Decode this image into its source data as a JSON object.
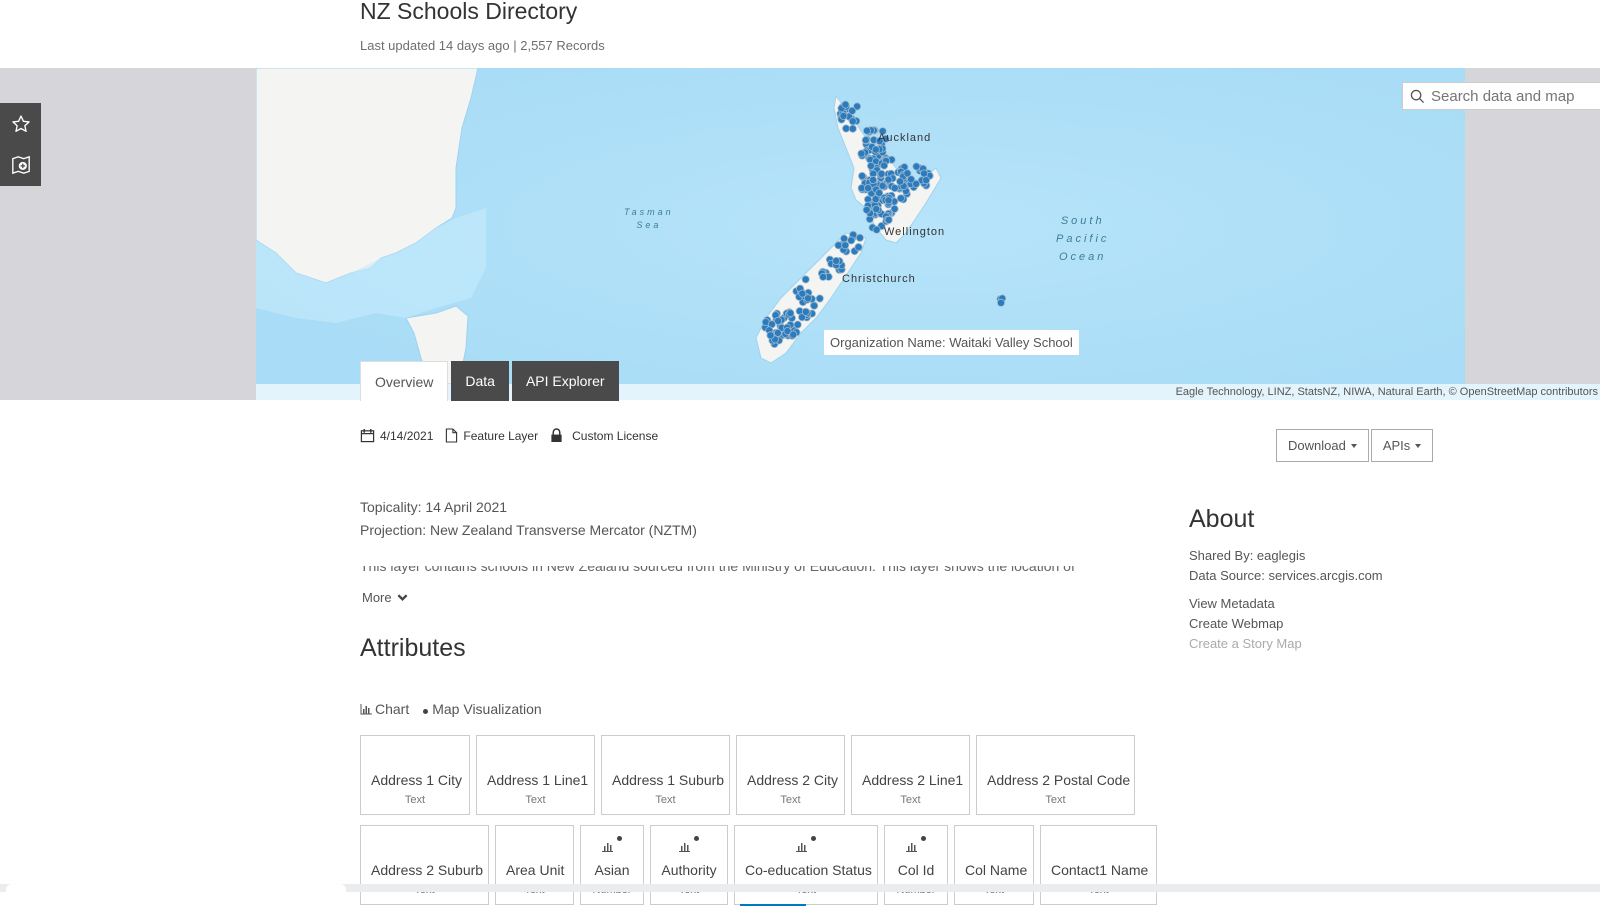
{
  "header": {
    "title": "NZ Schools Directory",
    "subtitle": "Last updated 14 days ago | 2,557 Records"
  },
  "side_toolbar": {
    "favorite_icon": "star-icon",
    "add_to_map_icon": "map-add-icon"
  },
  "search": {
    "placeholder": "Search data and map",
    "icon": "search-icon"
  },
  "map": {
    "labels": {
      "auckland": "Auckland",
      "wellington": "Wellington",
      "christchurch": "Christchurch",
      "tasman_line1": "Tasman",
      "tasman_line2": "Sea",
      "pacific_line1": "South",
      "pacific_line2": "Pacific",
      "pacific_line3": "Ocean"
    },
    "tooltip": "Organization Name: Waitaki Valley School",
    "attribution": "Eagle Technology, LINZ, StatsNZ, NIWA, Natural Earth, © OpenStreetMap contributors",
    "colors": {
      "water": "#aee1f9",
      "land": "#f4f4f2",
      "point": "#2b7bbf"
    }
  },
  "tabs": [
    {
      "label": "Overview",
      "active": true
    },
    {
      "label": "Data",
      "active": false
    },
    {
      "label": "API Explorer",
      "active": false
    }
  ],
  "meta": {
    "date": "4/14/2021",
    "type": "Feature Layer",
    "license": "Custom License"
  },
  "actions": {
    "download": "Download",
    "apis": "APIs"
  },
  "description": {
    "topicality": "Topicality: 14 April 2021",
    "projection": "Projection: New Zealand Transverse Mercator (NZTM)",
    "body_truncated": "This layer contains schools in New Zealand sourced from the Ministry of Education. This layer shows the location of",
    "more": "More"
  },
  "about": {
    "heading": "About",
    "shared_by": "Shared By: eaglegis",
    "data_source": "Data Source: services.arcgis.com",
    "links": [
      "View Metadata",
      "Create Webmap",
      "Create a Story Map"
    ]
  },
  "attributes": {
    "heading": "Attributes",
    "viz_options": {
      "chart": "Chart",
      "map": "Map Visualization"
    },
    "row1": [
      {
        "name": "Address 1 City",
        "type": "Text"
      },
      {
        "name": "Address 1 Line1",
        "type": "Text"
      },
      {
        "name": "Address 1 Suburb",
        "type": "Text"
      },
      {
        "name": "Address 2 City",
        "type": "Text"
      },
      {
        "name": "Address 2 Line1",
        "type": "Text"
      },
      {
        "name": "Address 2 Postal Code",
        "type": "Text"
      }
    ],
    "row2": [
      {
        "name": "Address 2 Suburb",
        "type": "Text",
        "icons": false
      },
      {
        "name": "Area Unit",
        "type": "Text",
        "icons": false
      },
      {
        "name": "Asian",
        "type": "Number",
        "icons": true
      },
      {
        "name": "Authority",
        "type": "Text",
        "icons": true
      },
      {
        "name": "Co-education Status",
        "type": "Text",
        "icons": true
      },
      {
        "name": "Col Id",
        "type": "Number",
        "icons": true
      },
      {
        "name": "Col Name",
        "type": "Text",
        "icons": false
      },
      {
        "name": "Contact1 Name",
        "type": "Text",
        "icons": false
      }
    ]
  }
}
